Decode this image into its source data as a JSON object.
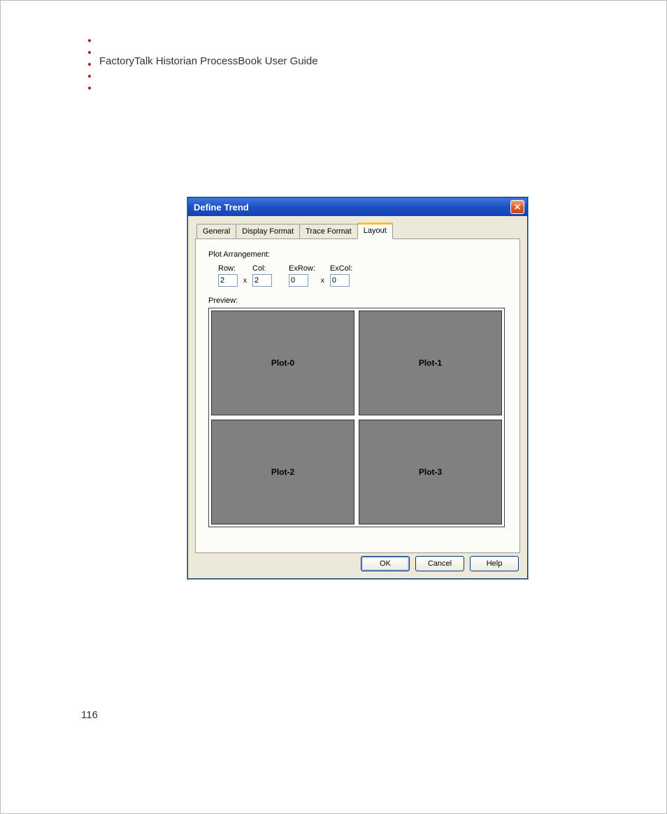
{
  "doc": {
    "header": "FactoryTalk Historian ProcessBook User Guide",
    "page_number": "116"
  },
  "dialog": {
    "title": "Define Trend",
    "tabs": {
      "general": "General",
      "display_format": "Display Format",
      "trace_format": "Trace Format",
      "layout": "Layout"
    },
    "layout_tab": {
      "plot_arrangement_label": "Plot Arrangement:",
      "row_label": "Row:",
      "col_label": "Col:",
      "exrow_label": "ExRow:",
      "excol_label": "ExCol:",
      "row_value": "2",
      "col_value": "2",
      "exrow_value": "0",
      "excol_value": "0",
      "times": "x",
      "preview_label": "Preview:",
      "plots": {
        "p0": "Plot-0",
        "p1": "Plot-1",
        "p2": "Plot-2",
        "p3": "Plot-3"
      }
    },
    "buttons": {
      "ok": "OK",
      "cancel": "Cancel",
      "help": "Help"
    },
    "close_glyph": "✕"
  }
}
